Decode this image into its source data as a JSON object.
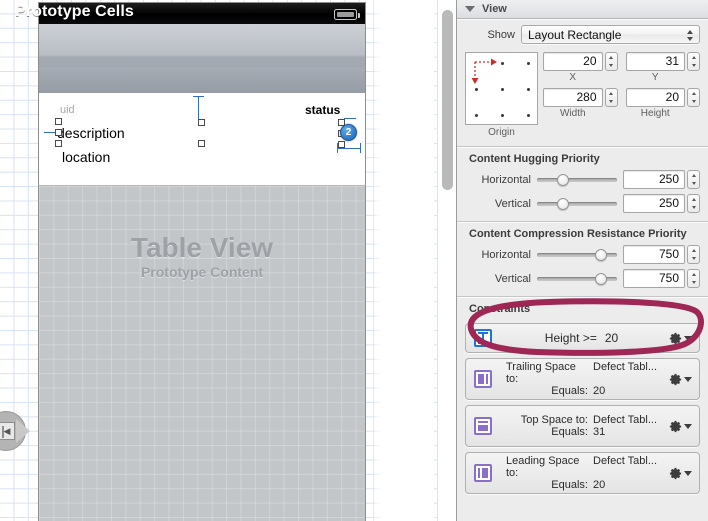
{
  "canvas": {
    "scene_title": "Prototype Cells",
    "cell_labels": {
      "uid": "uid",
      "description": "description",
      "location": "location",
      "status": "status"
    },
    "badge_text": "2",
    "table_view": {
      "title": "Table View",
      "subtitle": "Prototype Content"
    },
    "status_bar_icon": "battery-icon",
    "panel_toggle_icon": "show-left-panel-icon"
  },
  "inspector": {
    "header_title": "View",
    "show": {
      "label": "Show",
      "value": "Layout Rectangle"
    },
    "geometry": {
      "origin_label": "Origin",
      "x": {
        "label": "X",
        "value": "20"
      },
      "y": {
        "label": "Y",
        "value": "31"
      },
      "width": {
        "label": "Width",
        "value": "280"
      },
      "height": {
        "label": "Height",
        "value": "20"
      }
    },
    "content_hugging": {
      "title": "Content Hugging Priority",
      "horizontal": {
        "label": "Horizontal",
        "value": "250"
      },
      "vertical": {
        "label": "Vertical",
        "value": "250"
      }
    },
    "compression_resistance": {
      "title": "Content Compression Resistance Priority",
      "horizontal": {
        "label": "Horizontal",
        "value": "750"
      },
      "vertical": {
        "label": "Vertical",
        "value": "750"
      }
    },
    "constraints": {
      "title": "Constraints",
      "items": [
        {
          "icon": "height-constraint-icon",
          "selected": true,
          "relation": "Height >=",
          "amount": "20",
          "gear": "gear-icon"
        },
        {
          "icon": "trailing-space-constraint-icon",
          "selected": false,
          "key1": "Trailing Space to:",
          "val1": "Defect Tabl...",
          "key2": "Equals:",
          "val2": "20",
          "gear": "gear-icon"
        },
        {
          "icon": "top-space-constraint-icon",
          "selected": false,
          "key1": "Top Space to:",
          "val1": "Defect Tabl...",
          "key2": "Equals:",
          "val2": "31",
          "gear": "gear-icon"
        },
        {
          "icon": "leading-space-constraint-icon",
          "selected": false,
          "key1": "Leading Space to:",
          "val1": "Defect Tabl...",
          "key2": "Equals:",
          "val2": "20",
          "gear": "gear-icon"
        }
      ]
    }
  },
  "annotation": {
    "shape": "hand-drawn-ellipse",
    "color": "#9e2756",
    "targets": "constraints.items.0"
  },
  "colors": {
    "accent_blue": "#1f74d6",
    "constraint_purple": "#8a6fc8",
    "annotation": "#9e2756",
    "inspector_bg": "#ececec",
    "canvas_grid": "#d7e3f2"
  }
}
